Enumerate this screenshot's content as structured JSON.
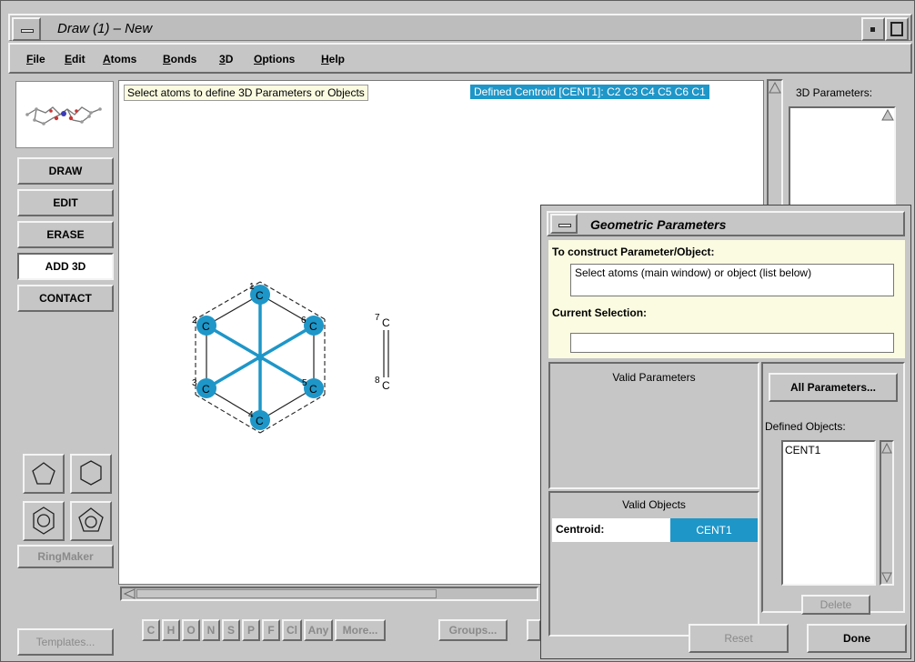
{
  "window": {
    "title": "Draw (1) – New",
    "menu": [
      "File",
      "Edit",
      "Atoms",
      "Bonds",
      "3D",
      "Options",
      "Help"
    ],
    "menu_underline": [
      "F",
      "E",
      "A",
      "B",
      "3",
      "O",
      "H"
    ]
  },
  "sidebar": {
    "buttons": [
      "DRAW",
      "EDIT",
      "ERASE",
      "ADD 3D",
      "CONTACT"
    ],
    "active": "ADD 3D",
    "ringmaker": "RingMaker",
    "templates": "Templates..."
  },
  "canvas": {
    "hint": "Select atoms to define 3D Parameters or Objects",
    "centroid_info": "Defined Centroid [CENT1]: C2 C3 C4 C5 C6 C1",
    "ring_atoms": [
      {
        "num": "1",
        "el": "C"
      },
      {
        "num": "2",
        "el": "C"
      },
      {
        "num": "3",
        "el": "C"
      },
      {
        "num": "4",
        "el": "C"
      },
      {
        "num": "5",
        "el": "C"
      },
      {
        "num": "6",
        "el": "C"
      }
    ],
    "other_atoms": [
      {
        "num": "7",
        "el": "C"
      },
      {
        "num": "8",
        "el": "C"
      }
    ]
  },
  "params3d": {
    "label": "3D Parameters:"
  },
  "toolbar": {
    "elements": [
      "C",
      "H",
      "O",
      "N",
      "S",
      "P",
      "F",
      "Cl",
      "Any",
      "More...",
      "Groups..."
    ]
  },
  "dialog": {
    "title": "Geometric Parameters",
    "construct_label": "To construct Parameter/Object:",
    "construct_text": "Select atoms (main window) or object (list below)",
    "selection_label": "Current Selection:",
    "selection_value": "",
    "valid_params": "Valid Parameters",
    "valid_objects": "Valid Objects",
    "objects": [
      {
        "type": "Centroid:",
        "name": "CENT1"
      }
    ],
    "all_params_button": "All Parameters...",
    "defined_objects_label": "Defined Objects:",
    "defined_objects": [
      "CENT1"
    ],
    "delete_button": "Delete",
    "reset_button": "Reset",
    "done_button": "Done"
  },
  "colors": {
    "selection": "#1e96c8",
    "atom": "#1e96c8",
    "panel": "#c6c6c6",
    "hint_bg": "#fbfbe2"
  }
}
